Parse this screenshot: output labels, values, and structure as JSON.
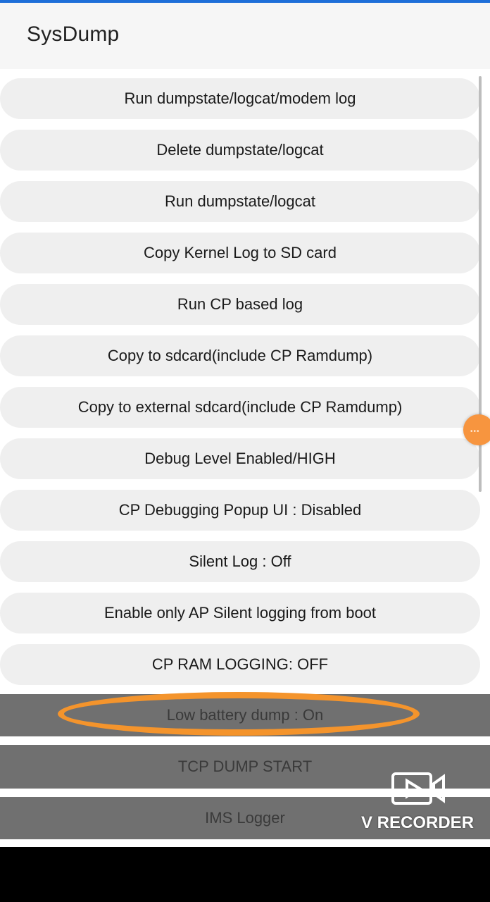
{
  "app": {
    "title": "SysDump"
  },
  "buttons": [
    "Run dumpstate/logcat/modem log",
    "Delete dumpstate/logcat",
    "Run dumpstate/logcat",
    "Copy Kernel Log to SD card",
    "Run CP based log",
    "Copy to sdcard(include CP Ramdump)",
    "Copy to external sdcard(include CP Ramdump)",
    "Debug Level Enabled/HIGH",
    "CP Debugging Popup UI : Disabled",
    "Silent Log : Off",
    "Enable only AP Silent logging from boot",
    "CP RAM LOGGING: OFF"
  ],
  "dark_buttons": [
    "Low battery dump : On",
    "TCP DUMP START",
    "IMS Logger"
  ],
  "overlay": {
    "recorder_label": "V RECORDER"
  },
  "colors": {
    "accent_highlight": "#f4942c",
    "fab": "#f7953f",
    "top_line": "#1e6fd9"
  }
}
